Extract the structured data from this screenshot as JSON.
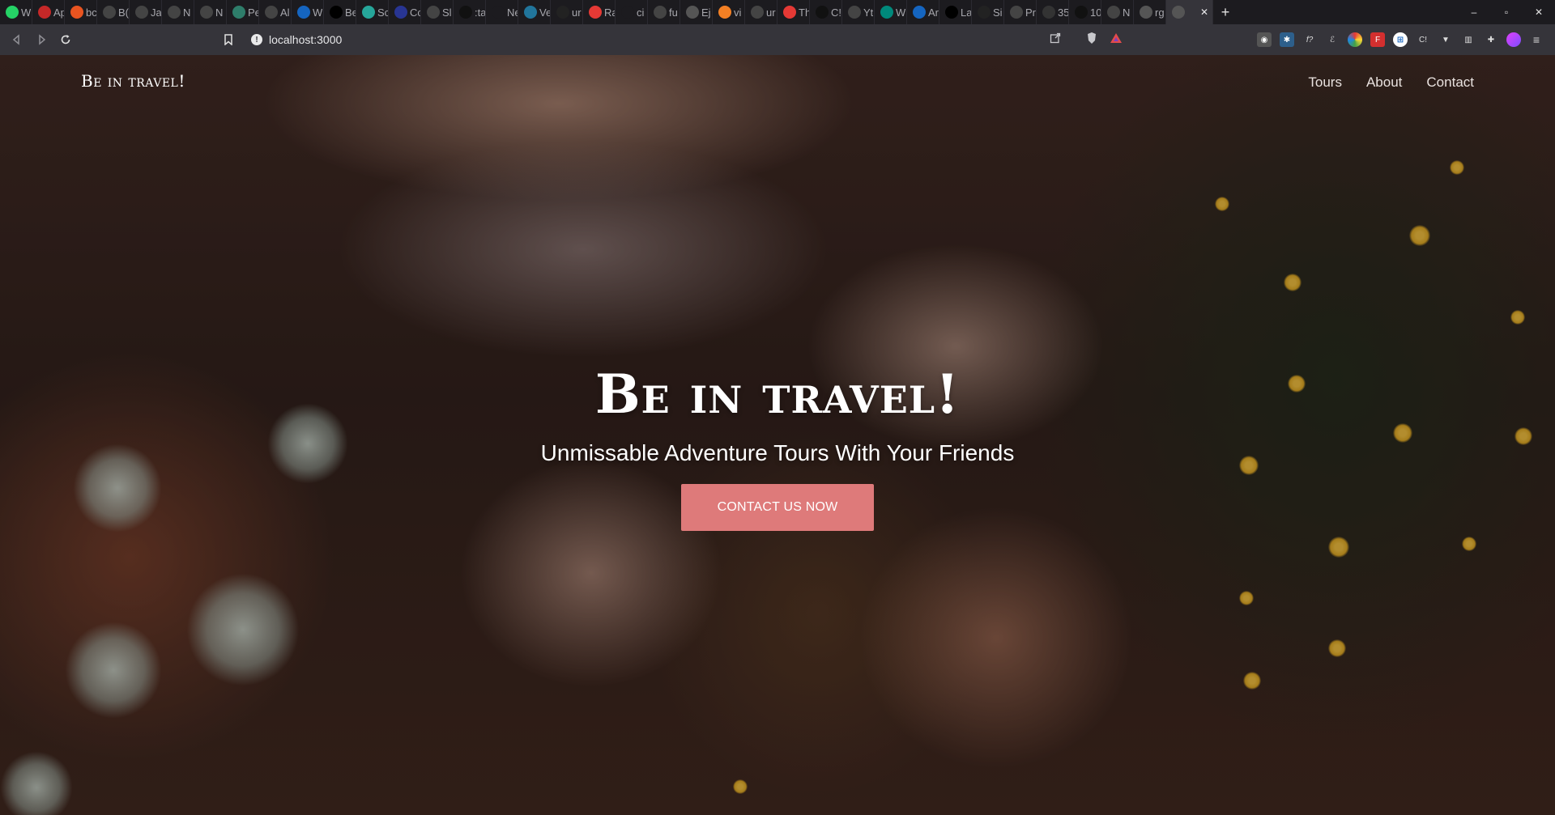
{
  "browser": {
    "tabs": [
      {
        "title": "W",
        "icon": "whatsapp-icon",
        "color": "#25d366"
      },
      {
        "title": "Ap",
        "icon": "app-icon",
        "color": "#c62828"
      },
      {
        "title": "bc",
        "icon": "ubuntu-icon",
        "color": "#e95420"
      },
      {
        "title": "B(",
        "icon": "globe-icon",
        "color": "#444444"
      },
      {
        "title": "Ja",
        "icon": "globe-icon",
        "color": "#444444"
      },
      {
        "title": "N",
        "icon": "globe-icon",
        "color": "#444444"
      },
      {
        "title": "N",
        "icon": "globe-icon",
        "color": "#444444"
      },
      {
        "title": "Pe",
        "icon": "shield-icon",
        "color": "#2e7d6a"
      },
      {
        "title": "Al",
        "icon": "globe-icon",
        "color": "#444444"
      },
      {
        "title": "W",
        "icon": "flag-icon",
        "color": "#1565c0"
      },
      {
        "title": "Be",
        "icon": "dev-icon",
        "color": "#000000"
      },
      {
        "title": "Sc",
        "icon": "wave-icon",
        "color": "#26a69a"
      },
      {
        "title": "Cc",
        "icon": "codepen-icon",
        "color": "#283593"
      },
      {
        "title": "Sl",
        "icon": "globe-icon",
        "color": "#444444"
      },
      {
        "title": ":ta",
        "icon": "chat-icon",
        "color": "#111111"
      },
      {
        "title": "New",
        "icon": "blank-icon",
        "color": "#1c1b1f"
      },
      {
        "title": "Ve",
        "icon": "wordpress-icon",
        "color": "#21759b"
      },
      {
        "title": "ur",
        "icon": "github-icon",
        "color": "#222222"
      },
      {
        "title": "Ra",
        "icon": "react-icon",
        "color": "#e53935"
      },
      {
        "title": "ci",
        "icon": "blank-icon",
        "color": "#1c1b1f"
      },
      {
        "title": "fu",
        "icon": "globe-icon",
        "color": "#444444"
      },
      {
        "title": "Ej",
        "icon": "circle-icon",
        "color": "#555555"
      },
      {
        "title": "vi",
        "icon": "stack-icon",
        "color": "#f48024"
      },
      {
        "title": "ur",
        "icon": "globe-icon",
        "color": "#444444"
      },
      {
        "title": "Th",
        "icon": "star-icon",
        "color": "#e53935"
      },
      {
        "title": "C!",
        "icon": "chat-icon",
        "color": "#111111"
      },
      {
        "title": "Yt",
        "icon": "globe-icon",
        "color": "#444444"
      },
      {
        "title": "W",
        "icon": "box-icon",
        "color": "#00897b"
      },
      {
        "title": "Ar",
        "icon": "doc-icon",
        "color": "#1565c0"
      },
      {
        "title": "La",
        "icon": "dev-icon",
        "color": "#000000"
      },
      {
        "title": "Si",
        "icon": "github-icon",
        "color": "#222222"
      },
      {
        "title": "Pr",
        "icon": "globe-icon",
        "color": "#444444"
      },
      {
        "title": "35",
        "icon": "app-icon",
        "color": "#333333"
      },
      {
        "title": "10",
        "icon": "infinity-icon",
        "color": "#111111"
      },
      {
        "title": "N",
        "icon": "globe-icon",
        "color": "#444444"
      },
      {
        "title": "rg",
        "icon": "circle-icon",
        "color": "#555555"
      }
    ],
    "active_tab_icon": "globe-icon",
    "close_glyph": "✕",
    "new_tab_glyph": "+",
    "window_controls": [
      "–",
      "▫",
      "✕"
    ],
    "url": "localhost:3000"
  },
  "site": {
    "brand": "Be in travel!",
    "nav": [
      "Tours",
      "About",
      "Contact"
    ],
    "hero_title": "Be in travel!",
    "hero_subtitle": "Unmissable Adventure Tours With Your Friends",
    "cta_label": "CONTACT US NOW",
    "colors": {
      "cta": "#de7a7a",
      "text": "#ffffff"
    }
  }
}
